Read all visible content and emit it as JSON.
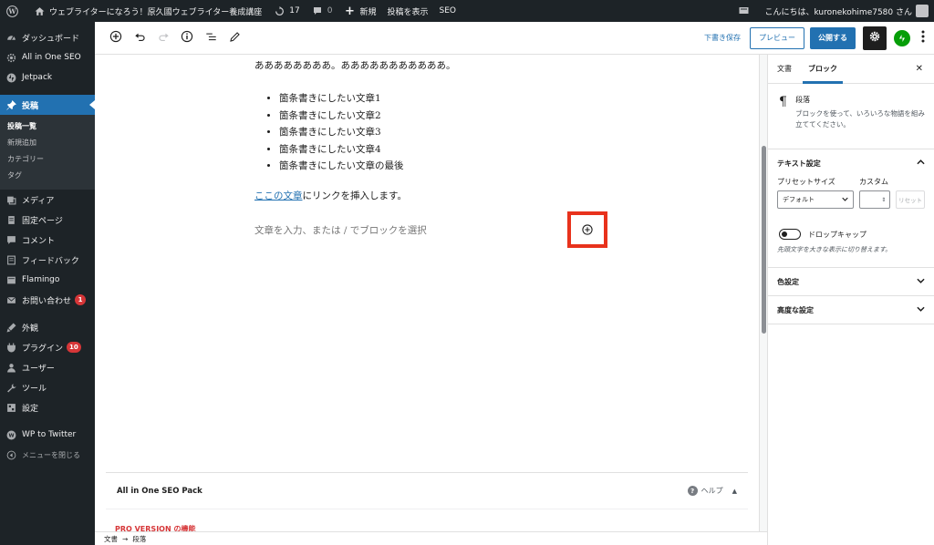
{
  "admin_bar": {
    "site_name": "ウェブライターになろう！原久國ウェブライター養成講座",
    "updates_count": "17",
    "comments_count": "0",
    "new_label": "新規",
    "view_post_label": "投稿を表示",
    "seo_label": "SEO",
    "greeting": "こんにちは、kuronekohime7580 さん"
  },
  "sidebar": {
    "items": [
      {
        "label": "ダッシュボード",
        "icon": "dashboard-icon"
      },
      {
        "label": "All in One SEO",
        "icon": "aioseo-icon"
      },
      {
        "label": "Jetpack",
        "icon": "jetpack-icon"
      },
      {
        "label": "投稿",
        "icon": "pin-icon",
        "current": true
      },
      {
        "label": "メディア",
        "icon": "media-icon"
      },
      {
        "label": "固定ページ",
        "icon": "page-icon"
      },
      {
        "label": "コメント",
        "icon": "comment-icon"
      },
      {
        "label": "フィードバック",
        "icon": "feedback-icon"
      },
      {
        "label": "Flamingo",
        "icon": "flamingo-icon"
      },
      {
        "label": "お問い合わせ",
        "icon": "mail-icon",
        "badge": "1"
      },
      {
        "label": "外観",
        "icon": "appearance-icon"
      },
      {
        "label": "プラグイン",
        "icon": "plugin-icon",
        "badge": "10"
      },
      {
        "label": "ユーザー",
        "icon": "user-icon"
      },
      {
        "label": "ツール",
        "icon": "tool-icon"
      },
      {
        "label": "設定",
        "icon": "settings-icon"
      },
      {
        "label": "WP to Twitter",
        "icon": "twitter-icon"
      }
    ],
    "submenu": [
      "投稿一覧",
      "新規追加",
      "カテゴリー",
      "タグ"
    ],
    "collapse_label": "メニューを閉じる"
  },
  "toolbar": {
    "save_draft": "下書き保存",
    "preview": "プレビュー",
    "publish": "公開する"
  },
  "post": {
    "paragraph": "ああああああああ。あああああああああああ。",
    "list_items": [
      "箇条書きにしたい文章1",
      "箇条書きにしたい文章2",
      "箇条書きにしたい文章3",
      "箇条書きにしたい文章4",
      "箇条書きにしたい文章の最後"
    ],
    "link_text": "ここの文章",
    "link_suffix": "にリンクを挿入します。",
    "placeholder": "文章を入力、または / でブロックを選択"
  },
  "metabox": {
    "title": "All in One SEO Pack",
    "help": "ヘルプ",
    "pro_version": "PRO VERSION の機能"
  },
  "footer": {
    "breadcrumb_root": "文書",
    "breadcrumb_current": "段落"
  },
  "settings": {
    "tab_document": "文書",
    "tab_block": "ブロック",
    "block_name": "段落",
    "block_desc": "ブロックを使って、いろいろな物語を組み立ててください。",
    "text_settings": "テキスト設定",
    "preset_size_label": "プリセットサイズ",
    "custom_label": "カスタム",
    "preset_value": "デフォルト",
    "reset_label": "リセット",
    "drop_cap_label": "ドロップキャップ",
    "drop_cap_help": "先頭文字を大きな表示に切り替えます。",
    "color_settings": "色設定",
    "advanced_settings": "高度な設定"
  },
  "colors": {
    "accent": "#2271b1",
    "admin_bg": "#1d2327",
    "highlight": "#e8321c",
    "badge": "#d63638",
    "jetpack": "#069e08"
  }
}
